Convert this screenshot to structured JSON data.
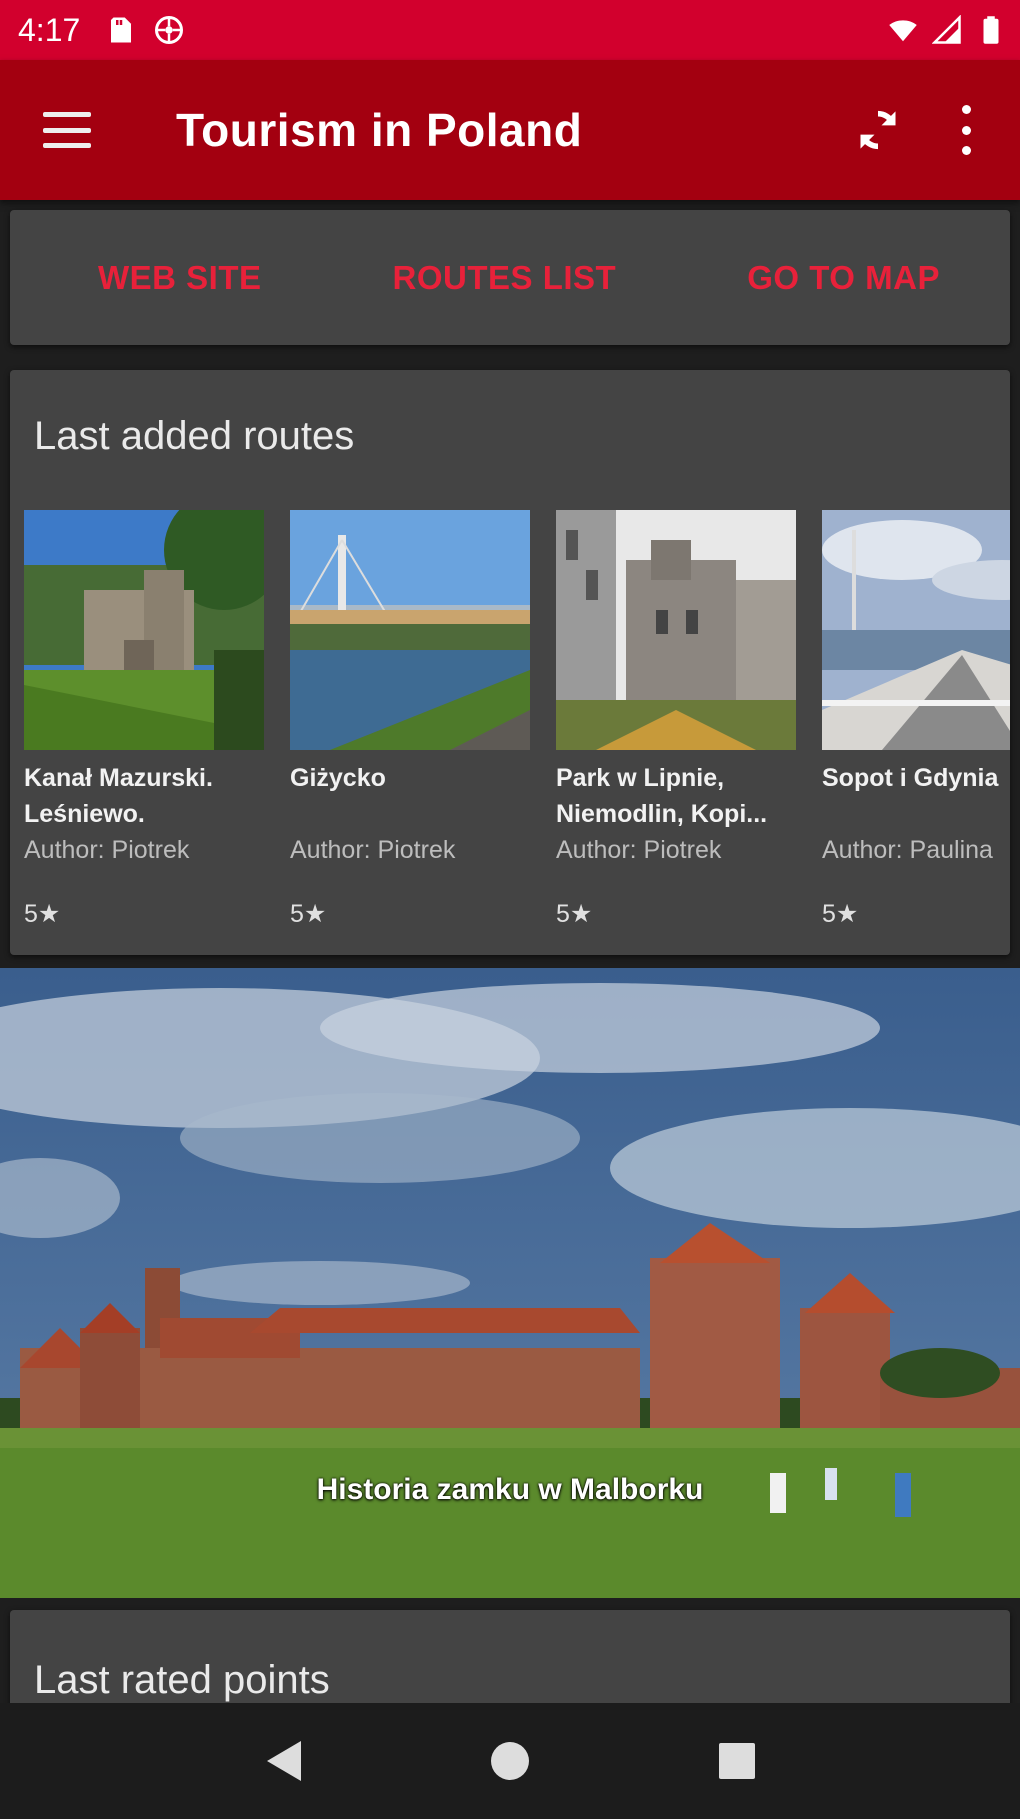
{
  "status_bar": {
    "time": "4:17",
    "icons": [
      "sd-card-icon",
      "settings-app-icon",
      "wifi-icon",
      "signal-icon",
      "battery-icon"
    ]
  },
  "app_bar": {
    "title": "Tourism in Poland",
    "menu_icon": "hamburger-menu-icon",
    "refresh_icon": "refresh-icon",
    "overflow_icon": "overflow-menu-icon"
  },
  "actions": {
    "web_site": "WEB SITE",
    "routes_list": "ROUTES LIST",
    "go_to_map": "GO TO MAP"
  },
  "last_added_routes": {
    "title": "Last added routes",
    "items": [
      {
        "name": "Kanał Mazurski. Leśniewo.",
        "author": "Author: Piotrek",
        "rating": "5★"
      },
      {
        "name": "Giżycko",
        "author": "Author: Piotrek",
        "rating": "5★"
      },
      {
        "name": "Park w Lipnie, Niemodlin, Kopi...",
        "author": "Author: Piotrek",
        "rating": "5★"
      },
      {
        "name": "Sopot i Gdynia",
        "author": "Author: Paulina",
        "rating": "5★"
      }
    ]
  },
  "featured": {
    "caption": "Historia zamku w Malborku"
  },
  "last_rated_points": {
    "title": "Last rated points"
  },
  "colors": {
    "status_bar": "#d2002d",
    "app_bar": "#a30010",
    "accent": "#e8213a",
    "card": "#444444",
    "background": "#1e1e1e"
  },
  "nav": {
    "icons": [
      "back-icon",
      "home-icon",
      "recents-icon"
    ]
  }
}
